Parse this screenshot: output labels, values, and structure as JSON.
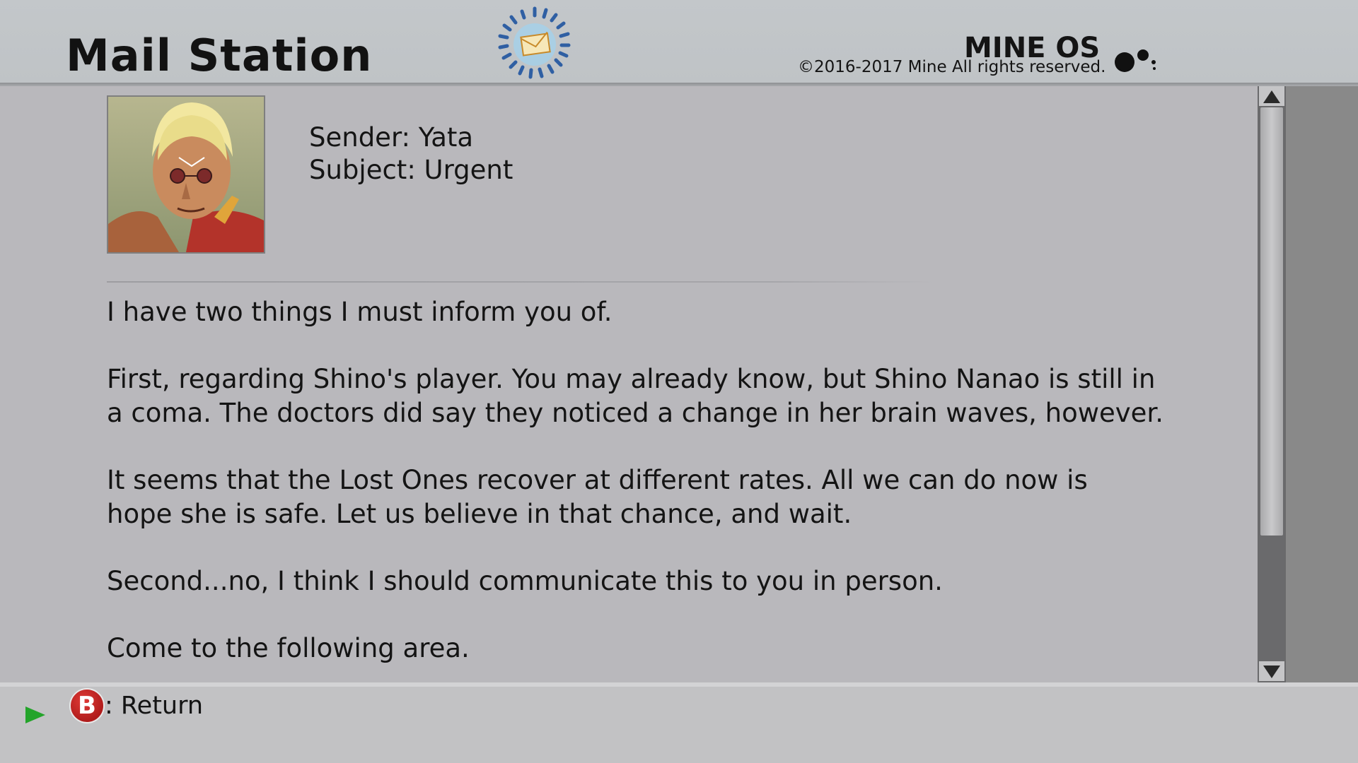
{
  "header": {
    "title": "Mail Station",
    "os_name": "MINE OS",
    "copyright": "©2016-2017 Mine All rights reserved."
  },
  "mail": {
    "sender": "Sender: Yata",
    "subject": "Subject: Urgent",
    "body": [
      "I have two things I must inform you of.",
      "First, regarding Shino's player. You may already know, but Shino Nanao is still in\na coma. The doctors did say they noticed a change in her brain waves, however.",
      "It seems that the Lost Ones recover at different rates. All we can do now is\nhope she is safe. Let us believe in that chance, and wait.",
      "Second...no, I think I should communicate this to you in person.",
      "Come to the following area."
    ]
  },
  "footer": {
    "button_glyph": "B",
    "return_label": ": Return"
  },
  "icons": {
    "mail_logo": "envelope-icon",
    "os_dots": "mine-os-dots-icon",
    "return_button": "b-button-icon"
  },
  "colors": {
    "background": "#b9b8bc",
    "header": "#c3c7ca",
    "scrollbar_track": "#6a6a6c",
    "b_button": "#c42424",
    "pointer_arrow": "#23a42a"
  }
}
